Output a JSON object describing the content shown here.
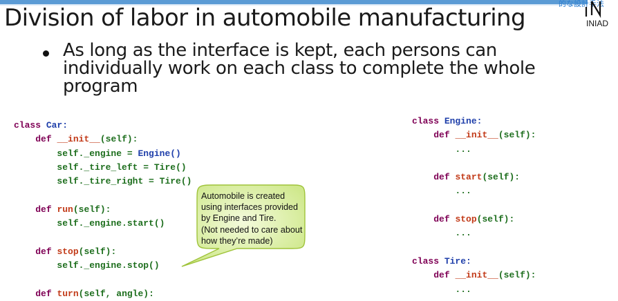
{
  "header": {
    "title": "Division of labor in automobile manufacturing",
    "tagline": "的な設計手法",
    "logo_text": "INIAD"
  },
  "bullet": "As long as the interface is kept, each persons can individually work on each class to complete the whole program",
  "callout": {
    "lines": [
      "Automobile is created",
      "using interfaces provided",
      "by Engine and Tire.",
      "(Not needed to care about",
      "how they’re made)"
    ]
  },
  "code_left": {
    "l0": {
      "kw": "class",
      "name": "Car:"
    },
    "l1": {
      "kw": "def",
      "fn": "__init__",
      "sig": "(self):"
    },
    "l2": {
      "obj": "self._engine = ",
      "call": "Engine()"
    },
    "l3": {
      "obj": "self._tire_left = ",
      "call": "Tire()"
    },
    "l4": {
      "obj": "self._tire_right = ",
      "call": "Tire()"
    },
    "l5": {
      "kw": "def",
      "fn": "run",
      "sig": "(self):"
    },
    "l6": {
      "stmt": "self._engine.start()"
    },
    "l7": {
      "kw": "def",
      "fn": "stop",
      "sig": "(self):"
    },
    "l8": {
      "stmt": "self._engine.stop()"
    },
    "l9": {
      "kw": "def",
      "fn": "turn",
      "sig": "(self, angle):"
    }
  },
  "code_right": {
    "r0": {
      "kw": "class",
      "name": "Engine:"
    },
    "r1": {
      "kw": "def",
      "fn": "__init__",
      "sig": "(self):"
    },
    "r2": {
      "ellipsis": "..."
    },
    "r3": {
      "kw": "def",
      "fn": "start",
      "sig": "(self):"
    },
    "r4": {
      "ellipsis": "..."
    },
    "r5": {
      "kw": "def",
      "fn": "stop",
      "sig": "(self):"
    },
    "r6": {
      "ellipsis": "..."
    },
    "r7": {
      "kw": "class",
      "name": "Tire:"
    },
    "r8": {
      "kw": "def",
      "fn": "__init__",
      "sig": "(self):"
    },
    "r9": {
      "ellipsis": "..."
    }
  },
  "colors": {
    "accent_bar": "#5b9bd5",
    "keyword": "#7f0055",
    "function": "#c23a18",
    "text_code": "#1d6e1d",
    "class_name": "#1f3faa",
    "callout_fill": "#d8ef9a",
    "callout_border": "#9fc33a"
  }
}
